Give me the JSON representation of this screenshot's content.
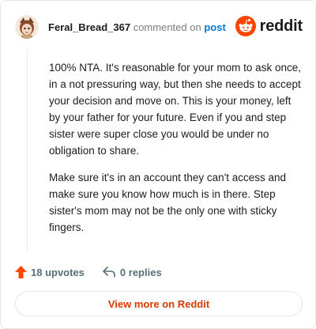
{
  "header": {
    "username": "Feral_Bread_367",
    "action_text": "commented on",
    "post_link": "post",
    "brand_name": "reddit"
  },
  "comment": {
    "paragraphs": [
      "100% NTA. It's reasonable for your mom to ask once, in a not pressuring way, but then she needs to accept your decision and move on. This is your money, left by your father for your future. Even if you and step sister were super close you would be under no obligation to share.",
      "Make sure it's in an account they can't access and make sure you know how much is in there. Step sister's mom may not be the only one with sticky fingers."
    ]
  },
  "footer": {
    "upvotes": "18 upvotes",
    "replies": "0 replies",
    "view_more": "View more on Reddit"
  },
  "colors": {
    "reddit_orange": "#ff4500",
    "link_blue": "#0079d3",
    "cta_text": "#d93a00"
  },
  "icons": {
    "avatar": "user-avatar",
    "brand": "reddit-logo-icon",
    "upvote": "upvote-arrow-icon",
    "reply": "reply-arrow-icon"
  }
}
